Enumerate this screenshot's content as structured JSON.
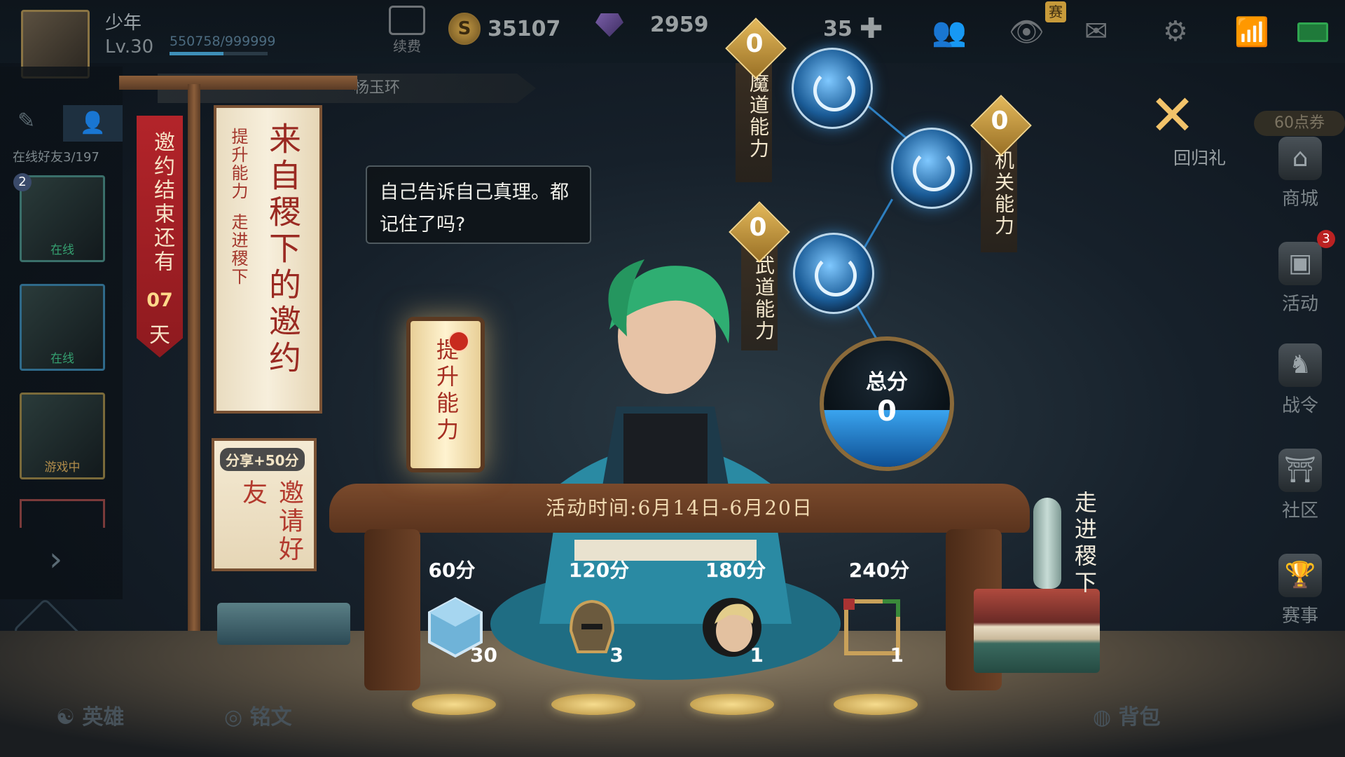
{
  "player": {
    "name": "少年",
    "level": "Lv.30",
    "exp": "550758/999999",
    "exp_fill": 0.55
  },
  "currencies": {
    "renew_label": "续费",
    "coins": "35107",
    "diamonds": "2959",
    "vouchers": "35"
  },
  "top_badge": "赛",
  "friends": {
    "online_text": "在线好友3/197",
    "status_online": "在线",
    "status_gaming": "游戏中",
    "rank_badge": "2"
  },
  "breadcrumb": "杨玉环",
  "countdown": {
    "text": "邀约结束还有",
    "days": "07",
    "unit": "天"
  },
  "scroll": {
    "subtitle_1": "提升能力",
    "subtitle_2": "走进稷下",
    "title": "来自稷下的邀约"
  },
  "invite": {
    "badge": "分享+50分",
    "label": "邀请好友"
  },
  "lantern_label": "提升能力",
  "dialog_text": "自己告诉自己真理。都记住了吗?",
  "abilities": [
    {
      "value": "0",
      "label": "魔道能力"
    },
    {
      "value": "0",
      "label": "机关能力"
    },
    {
      "value": "0",
      "label": "武道能力"
    }
  ],
  "total_score": {
    "label": "总分",
    "value": "0"
  },
  "event_time": "活动时间:6月14日-6月20日",
  "rewards": [
    {
      "points": "60分",
      "count": "30",
      "icon": "crystal-icon"
    },
    {
      "points": "120分",
      "count": "3",
      "icon": "helmet-icon"
    },
    {
      "points": "180分",
      "count": "1",
      "icon": "hero-portrait-icon"
    },
    {
      "points": "240分",
      "count": "1",
      "icon": "frame-icon"
    }
  ],
  "enter_label": "走进稷下",
  "right_panel": {
    "return_gift": "回归礼",
    "coupon": "60点券",
    "menu": [
      {
        "label": "商城",
        "icon": "shop-icon"
      },
      {
        "label": "活动",
        "icon": "activity-icon",
        "badge": "3"
      },
      {
        "label": "战令",
        "icon": "battle-pass-icon"
      },
      {
        "label": "社区",
        "icon": "community-icon"
      },
      {
        "label": "赛事",
        "icon": "trophy-icon"
      }
    ]
  },
  "bottom_nav": {
    "hero": "英雄",
    "inscription": "铭文",
    "bag": "背包"
  },
  "colors": {
    "gold": "#e3b85a",
    "red_banner": "#b3242a",
    "orb_blue": "#1a5b96",
    "wood": "#7a4a2c"
  }
}
